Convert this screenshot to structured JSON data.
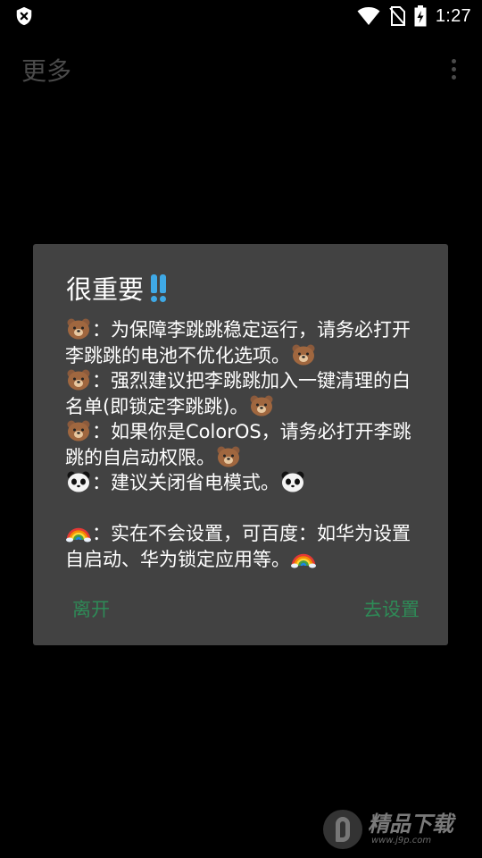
{
  "status_bar": {
    "time": "1:27",
    "icons": [
      "shield-close-icon",
      "wifi-icon",
      "no-sim-icon",
      "battery-charging-icon"
    ]
  },
  "app_bar": {
    "title": "更多",
    "menu_icon": "overflow-menu-icon"
  },
  "dialog": {
    "title": "很重要",
    "title_icon": "double-exclamation-icon",
    "lines": [
      {
        "emoji_start": "bear-emoji",
        "text": "：为保障李跳跳稳定运行，请务必打开李跳跳的电池不优化选项。",
        "emoji_end": "bear-emoji"
      },
      {
        "emoji_start": "bear-emoji",
        "text": "：强烈建议把李跳跳加入一键清理的白名单(即锁定李跳跳)。",
        "emoji_end": "bear-emoji"
      },
      {
        "emoji_start": "bear-emoji",
        "text": "：如果你是ColorOS，请务必打开李跳跳的自启动权限。",
        "emoji_end": "bear-emoji"
      },
      {
        "emoji_start": "panda-emoji",
        "text": "：建议关闭省电模式。",
        "emoji_end": "panda-emoji"
      },
      {
        "emoji_start": "rainbow-emoji",
        "text": "：实在不会设置，可百度：如华为设置自启动、华为锁定应用等。",
        "emoji_end": "rainbow-emoji"
      }
    ],
    "buttons": {
      "leave": "离开",
      "go_settings": "去设置"
    }
  },
  "watermark": {
    "main": "精品下载",
    "sub": "www.j9p.com"
  },
  "colors": {
    "background": "#000000",
    "dialog_bg": "#424242",
    "button_text": "#2e8b57",
    "dim_text": "#4a4a4a",
    "accent_blue": "#3fa9e6"
  }
}
